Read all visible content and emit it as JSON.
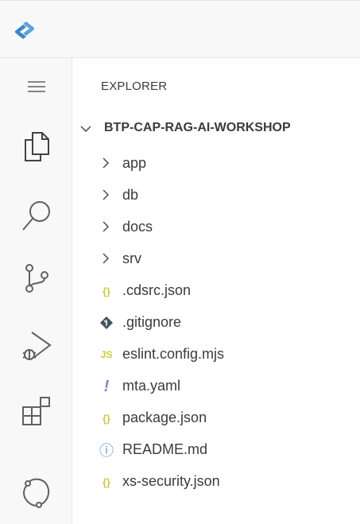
{
  "sidebar": {
    "title": "EXPLORER",
    "root": {
      "label": "BTP-CAP-RAG-AI-WORKSHOP",
      "expanded": true
    },
    "items": [
      {
        "label": "app",
        "type": "folder",
        "icon": "chevron-right-icon"
      },
      {
        "label": "db",
        "type": "folder",
        "icon": "chevron-right-icon"
      },
      {
        "label": "docs",
        "type": "folder",
        "icon": "chevron-right-icon"
      },
      {
        "label": "srv",
        "type": "folder",
        "icon": "chevron-right-icon"
      },
      {
        "label": ".cdsrc.json",
        "type": "file",
        "icon": "json-icon",
        "glyph": "{}",
        "color": "#cbcb41"
      },
      {
        "label": ".gitignore",
        "type": "file",
        "icon": "git-icon",
        "glyph": "◆",
        "color": "#41535b"
      },
      {
        "label": "eslint.config.mjs",
        "type": "file",
        "icon": "javascript-icon",
        "glyph": "JS",
        "color": "#cbcb41"
      },
      {
        "label": "mta.yaml",
        "type": "file",
        "icon": "yaml-icon",
        "glyph": "!",
        "color": "#a074c4"
      },
      {
        "label": "package.json",
        "type": "file",
        "icon": "json-icon",
        "glyph": "{}",
        "color": "#cbcb41"
      },
      {
        "label": "README.md",
        "type": "file",
        "icon": "info-icon",
        "glyph": "ⓘ",
        "color": "#519aba"
      },
      {
        "label": "xs-security.json",
        "type": "file",
        "icon": "json-icon",
        "glyph": "{}",
        "color": "#cbcb41"
      }
    ]
  },
  "activity_bar": {
    "items": [
      "menu-icon",
      "explorer-icon",
      "search-icon",
      "source-control-icon",
      "run-debug-icon",
      "extensions-icon",
      "remote-icon"
    ]
  },
  "colors": {
    "activity_icon": "#616161",
    "text": "#3b3b3b",
    "logo": "#3a87c8"
  }
}
